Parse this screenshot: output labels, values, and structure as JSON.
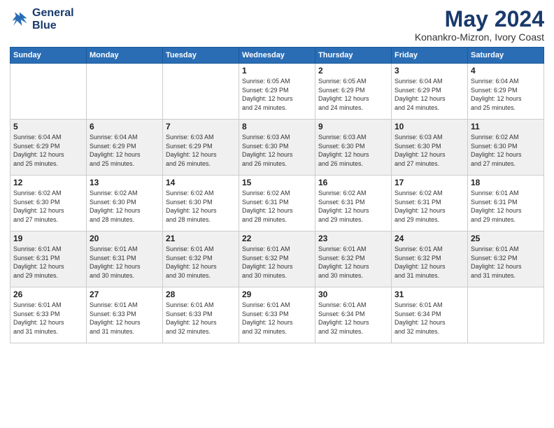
{
  "header": {
    "logo_line1": "General",
    "logo_line2": "Blue",
    "title": "May 2024",
    "subtitle": "Konankro-Mizron, Ivory Coast"
  },
  "calendar": {
    "days_of_week": [
      "Sunday",
      "Monday",
      "Tuesday",
      "Wednesday",
      "Thursday",
      "Friday",
      "Saturday"
    ],
    "weeks": [
      [
        {
          "day": "",
          "info": ""
        },
        {
          "day": "",
          "info": ""
        },
        {
          "day": "",
          "info": ""
        },
        {
          "day": "1",
          "info": "Sunrise: 6:05 AM\nSunset: 6:29 PM\nDaylight: 12 hours\nand 24 minutes."
        },
        {
          "day": "2",
          "info": "Sunrise: 6:05 AM\nSunset: 6:29 PM\nDaylight: 12 hours\nand 24 minutes."
        },
        {
          "day": "3",
          "info": "Sunrise: 6:04 AM\nSunset: 6:29 PM\nDaylight: 12 hours\nand 24 minutes."
        },
        {
          "day": "4",
          "info": "Sunrise: 6:04 AM\nSunset: 6:29 PM\nDaylight: 12 hours\nand 25 minutes."
        }
      ],
      [
        {
          "day": "5",
          "info": "Sunrise: 6:04 AM\nSunset: 6:29 PM\nDaylight: 12 hours\nand 25 minutes."
        },
        {
          "day": "6",
          "info": "Sunrise: 6:04 AM\nSunset: 6:29 PM\nDaylight: 12 hours\nand 25 minutes."
        },
        {
          "day": "7",
          "info": "Sunrise: 6:03 AM\nSunset: 6:29 PM\nDaylight: 12 hours\nand 26 minutes."
        },
        {
          "day": "8",
          "info": "Sunrise: 6:03 AM\nSunset: 6:30 PM\nDaylight: 12 hours\nand 26 minutes."
        },
        {
          "day": "9",
          "info": "Sunrise: 6:03 AM\nSunset: 6:30 PM\nDaylight: 12 hours\nand 26 minutes."
        },
        {
          "day": "10",
          "info": "Sunrise: 6:03 AM\nSunset: 6:30 PM\nDaylight: 12 hours\nand 27 minutes."
        },
        {
          "day": "11",
          "info": "Sunrise: 6:02 AM\nSunset: 6:30 PM\nDaylight: 12 hours\nand 27 minutes."
        }
      ],
      [
        {
          "day": "12",
          "info": "Sunrise: 6:02 AM\nSunset: 6:30 PM\nDaylight: 12 hours\nand 27 minutes."
        },
        {
          "day": "13",
          "info": "Sunrise: 6:02 AM\nSunset: 6:30 PM\nDaylight: 12 hours\nand 28 minutes."
        },
        {
          "day": "14",
          "info": "Sunrise: 6:02 AM\nSunset: 6:30 PM\nDaylight: 12 hours\nand 28 minutes."
        },
        {
          "day": "15",
          "info": "Sunrise: 6:02 AM\nSunset: 6:31 PM\nDaylight: 12 hours\nand 28 minutes."
        },
        {
          "day": "16",
          "info": "Sunrise: 6:02 AM\nSunset: 6:31 PM\nDaylight: 12 hours\nand 29 minutes."
        },
        {
          "day": "17",
          "info": "Sunrise: 6:02 AM\nSunset: 6:31 PM\nDaylight: 12 hours\nand 29 minutes."
        },
        {
          "day": "18",
          "info": "Sunrise: 6:01 AM\nSunset: 6:31 PM\nDaylight: 12 hours\nand 29 minutes."
        }
      ],
      [
        {
          "day": "19",
          "info": "Sunrise: 6:01 AM\nSunset: 6:31 PM\nDaylight: 12 hours\nand 29 minutes."
        },
        {
          "day": "20",
          "info": "Sunrise: 6:01 AM\nSunset: 6:31 PM\nDaylight: 12 hours\nand 30 minutes."
        },
        {
          "day": "21",
          "info": "Sunrise: 6:01 AM\nSunset: 6:32 PM\nDaylight: 12 hours\nand 30 minutes."
        },
        {
          "day": "22",
          "info": "Sunrise: 6:01 AM\nSunset: 6:32 PM\nDaylight: 12 hours\nand 30 minutes."
        },
        {
          "day": "23",
          "info": "Sunrise: 6:01 AM\nSunset: 6:32 PM\nDaylight: 12 hours\nand 30 minutes."
        },
        {
          "day": "24",
          "info": "Sunrise: 6:01 AM\nSunset: 6:32 PM\nDaylight: 12 hours\nand 31 minutes."
        },
        {
          "day": "25",
          "info": "Sunrise: 6:01 AM\nSunset: 6:32 PM\nDaylight: 12 hours\nand 31 minutes."
        }
      ],
      [
        {
          "day": "26",
          "info": "Sunrise: 6:01 AM\nSunset: 6:33 PM\nDaylight: 12 hours\nand 31 minutes."
        },
        {
          "day": "27",
          "info": "Sunrise: 6:01 AM\nSunset: 6:33 PM\nDaylight: 12 hours\nand 31 minutes."
        },
        {
          "day": "28",
          "info": "Sunrise: 6:01 AM\nSunset: 6:33 PM\nDaylight: 12 hours\nand 32 minutes."
        },
        {
          "day": "29",
          "info": "Sunrise: 6:01 AM\nSunset: 6:33 PM\nDaylight: 12 hours\nand 32 minutes."
        },
        {
          "day": "30",
          "info": "Sunrise: 6:01 AM\nSunset: 6:34 PM\nDaylight: 12 hours\nand 32 minutes."
        },
        {
          "day": "31",
          "info": "Sunrise: 6:01 AM\nSunset: 6:34 PM\nDaylight: 12 hours\nand 32 minutes."
        },
        {
          "day": "",
          "info": ""
        }
      ]
    ]
  }
}
